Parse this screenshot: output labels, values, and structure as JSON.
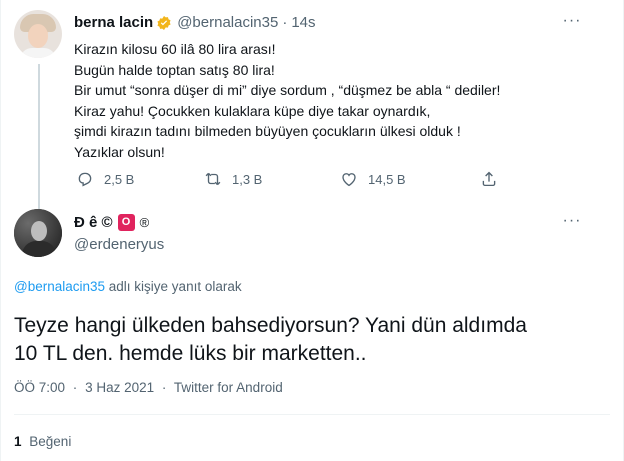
{
  "parent_tweet": {
    "author_name": "berna lacin",
    "author_handle": "@bernalacin35",
    "separator": "·",
    "time_ago": "14s",
    "verified_icon": "verified-badge-icon",
    "text_lines": [
      "Kirazın kilosu 60 ilâ 80 lira arası!",
      "Bugün halde toptan satış 80 lira!",
      "Bir umut “sonra düşer di mi” diye sordum , “düşmez be abla “ dediler!",
      "Kiraz yahu! Çocukken kulaklara küpe diye takar oynardık,",
      "şimdi kirazın tadını bilmeden büyüyen çocukların ülkesi olduk !",
      "Yazıklar olsun!"
    ],
    "actions": {
      "reply_count": "2,5 B",
      "retweet_count": "1,3 B",
      "like_count": "14,5 B"
    }
  },
  "reply_tweet": {
    "author_name_prefix": "Đ ê ©",
    "author_badge": "O",
    "author_name_suffix": "®",
    "author_handle": "@erdeneryus",
    "reply_to_mention": "@bernalacin35",
    "reply_to_suffix": "adlı kişiye yanıt olarak",
    "text_lines": [
      "Teyze hangi ülkeden bahsediyorsun? Yani dün aldımda",
      "10 TL den. hemde lüks bir marketten.."
    ],
    "time": "ÖÖ 7:00",
    "date": "3 Haz 2021",
    "source": "Twitter for Android",
    "meta_separator": "·",
    "likes_count": "1",
    "likes_label": "Beğeni"
  },
  "more_label": "···",
  "colors": {
    "accent": "#1d9bf0",
    "secondary_text": "#536471",
    "primary_text": "#0f1419",
    "badge": "#e0245e",
    "verified": "#f2b51b"
  }
}
